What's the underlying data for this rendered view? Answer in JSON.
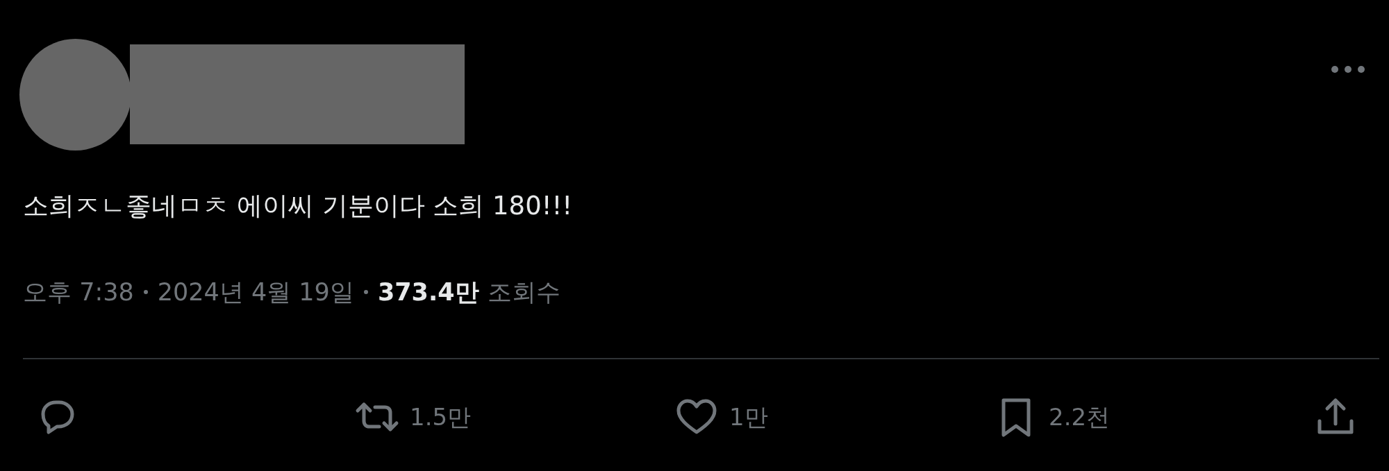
{
  "tweet": {
    "text": "소희ㅈㄴ좋네ㅁㅊ 에이씨 기분이다 소희 180!!!",
    "time": "오후 7:38",
    "date": "2024년 4월 19일",
    "views": "373.4만",
    "views_label": "조회수"
  },
  "actions": [
    {
      "kind": "reply",
      "active": false
    },
    {
      "kind": "retweet",
      "count": "1.5만",
      "active": false
    },
    {
      "kind": "like",
      "count": "1만",
      "active": false
    },
    {
      "kind": "bookmark",
      "count": "2.2천",
      "active": false
    },
    {
      "kind": "share",
      "active": false
    }
  ]
}
